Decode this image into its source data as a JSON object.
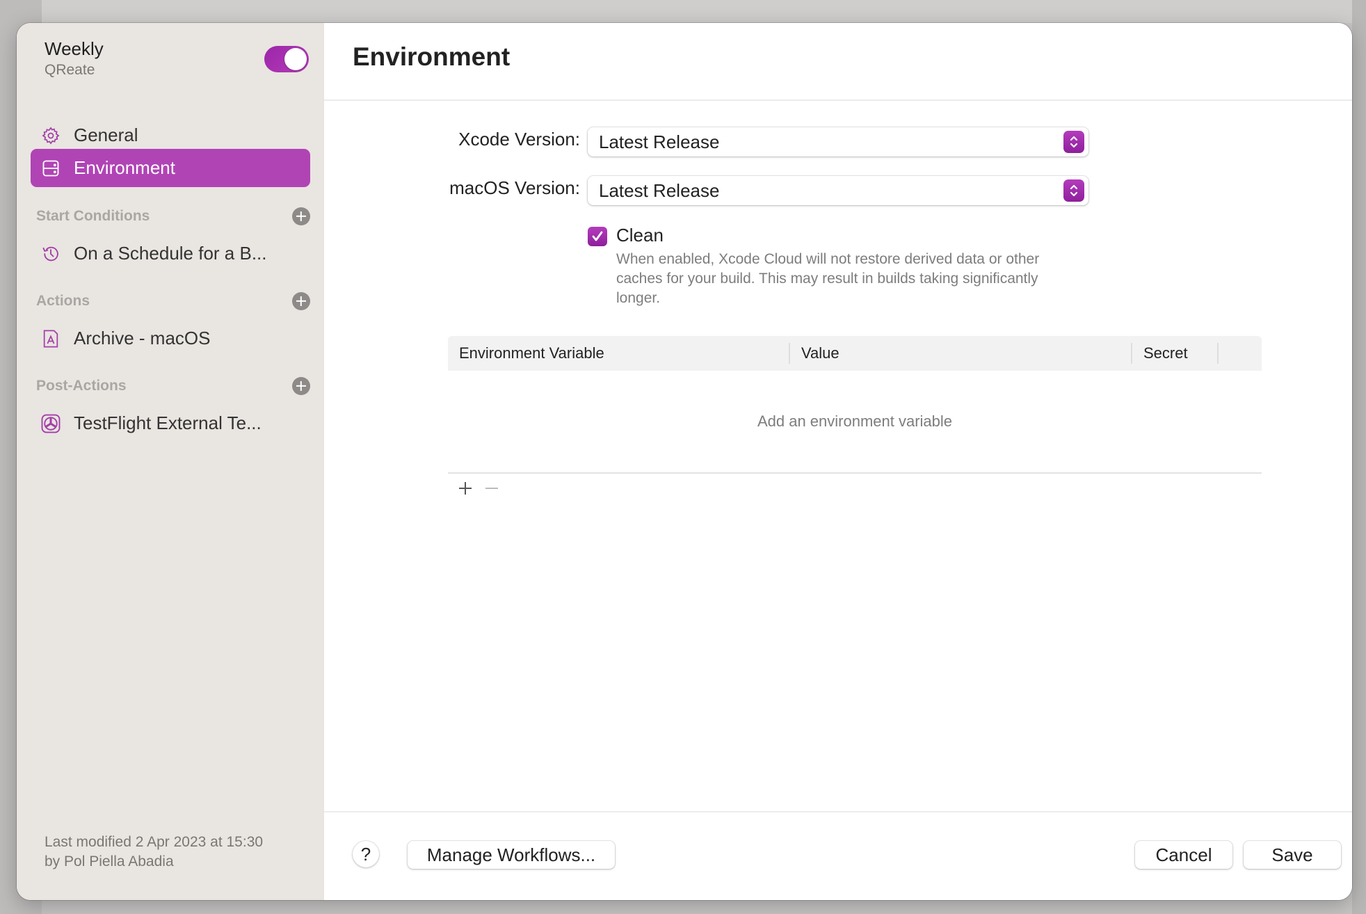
{
  "colors": {
    "accent": "#b044b5",
    "sidebar_bg": "#e9e5e1",
    "section_header": "#aaa6a3"
  },
  "workflow": {
    "name": "Weekly",
    "product": "QReate",
    "enabled": true
  },
  "sidebar": {
    "items": [
      {
        "label": "General",
        "icon": "gear-icon",
        "active": false
      },
      {
        "label": "Environment",
        "icon": "server-icon",
        "active": true
      }
    ],
    "sections": [
      {
        "title": "Start Conditions",
        "items": [
          {
            "label": "On a Schedule for a B...",
            "icon": "clock-history-icon"
          }
        ]
      },
      {
        "title": "Actions",
        "items": [
          {
            "label": "Archive - macOS",
            "icon": "app-archive-icon"
          }
        ]
      },
      {
        "title": "Post-Actions",
        "items": [
          {
            "label": "TestFlight External Te...",
            "icon": "testflight-icon"
          }
        ]
      }
    ],
    "footer": {
      "line1": "Last modified 2 Apr 2023 at 15:30",
      "line2": "by Pol Piella Abadia"
    }
  },
  "main": {
    "title": "Environment",
    "xcode_version": {
      "label": "Xcode Version:",
      "value": "Latest Release"
    },
    "macos_version": {
      "label": "macOS Version:",
      "value": "Latest Release"
    },
    "clean": {
      "label": "Clean",
      "checked": true,
      "description": "When enabled, Xcode Cloud will not restore derived data or other caches for your build. This may result in builds taking significantly longer."
    },
    "env_table": {
      "columns": [
        "Environment Variable",
        "Value",
        "Secret"
      ],
      "rows": [],
      "empty_message": "Add an environment variable",
      "add_label": "+",
      "remove_label": "−"
    }
  },
  "footer": {
    "help_label": "?",
    "manage_label": "Manage Workflows...",
    "cancel_label": "Cancel",
    "save_label": "Save"
  }
}
